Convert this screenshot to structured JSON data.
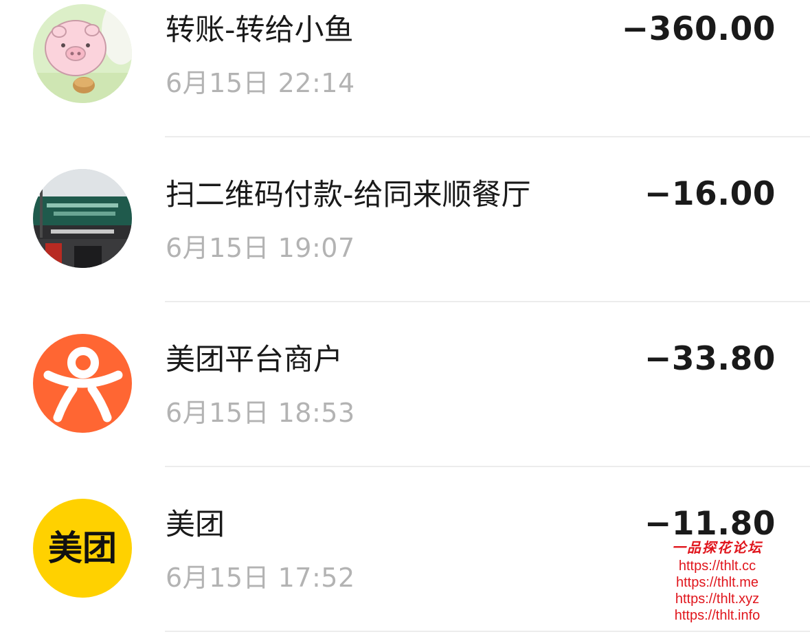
{
  "transactions": [
    {
      "title": "转账-转给小鱼",
      "time": "6月15日 22:14",
      "amount": "−360.00",
      "avatar": "pig-cartoon-avatar"
    },
    {
      "title": "扫二维码付款-给同来顺餐厅",
      "time": "6月15日 19:07",
      "amount": "−16.00",
      "avatar": "restaurant-storefront-avatar"
    },
    {
      "title": "美团平台商户",
      "time": "6月15日 18:53",
      "amount": "−33.80",
      "avatar": "dianping-logo-avatar",
      "avatar_color": "#ff6633"
    },
    {
      "title": "美团",
      "time": "6月15日 17:52",
      "amount": "−11.80",
      "avatar": "meituan-logo-avatar",
      "avatar_color": "#ffd100",
      "avatar_text": "美团"
    }
  ],
  "watermark": {
    "brand": "一品探花论坛",
    "links": [
      "https://thlt.cc",
      "https://thlt.me",
      "https://thlt.xyz",
      "https://thlt.info"
    ],
    "color": "#e0151c"
  }
}
